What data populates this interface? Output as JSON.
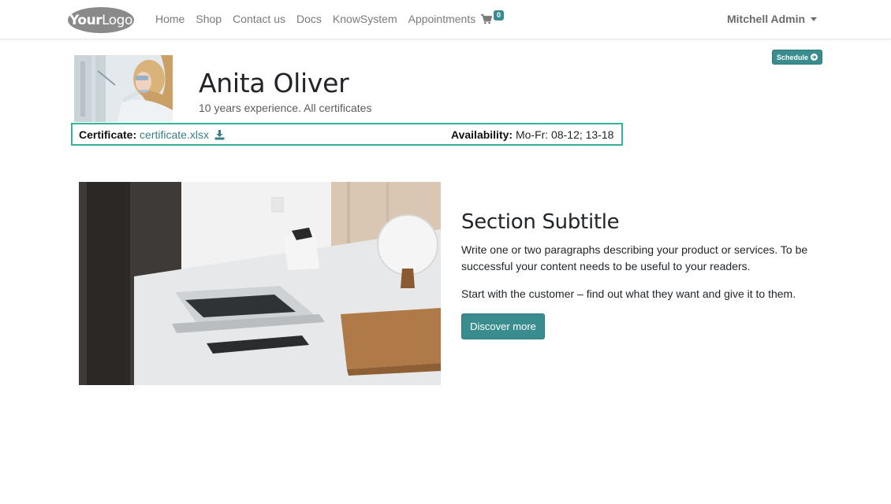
{
  "navbar": {
    "logo": {
      "bold": "Your",
      "thin": "Logo"
    },
    "links": [
      "Home",
      "Shop",
      "Contact us",
      "Docs",
      "KnowSystem",
      "Appointments"
    ],
    "cart": {
      "icon": "cart-icon",
      "count": "0"
    },
    "user": {
      "name": "Mitchell Admin",
      "icon": "caret-down-icon"
    }
  },
  "schedule": {
    "label": "Schedule",
    "icon": "arrow-circle-right-icon"
  },
  "profile": {
    "name": "Anita Oliver",
    "description": "10 years experience. All certificates",
    "certificate_label": "Certificate:",
    "certificate_file": "certificate.xlsx",
    "certificate_icon": "download-icon",
    "availability_label": "Availability:",
    "availability_value": "Mo-Fr: 08-12; 13-18"
  },
  "section": {
    "title": "Section Subtitle",
    "paragraph1": "Write one or two paragraphs describing your product or services. To be successful your content needs to be useful to your readers.",
    "paragraph2": "Start with the customer – find out what they want and give it to them.",
    "button": "Discover more"
  },
  "colors": {
    "accent": "#3a8d8f",
    "highlight_border": "#36b19c",
    "link": "#3a7f86"
  }
}
